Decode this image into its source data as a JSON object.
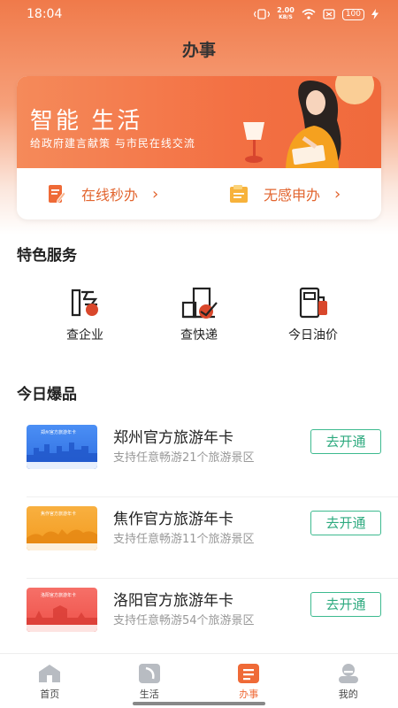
{
  "status_bar": {
    "time": "18:04",
    "net_speed_value": "2.00",
    "net_speed_unit": "KB/S",
    "battery": "100"
  },
  "header": {
    "title": "办事"
  },
  "banner": {
    "title": "智能 生活",
    "subtitle": "给政府建言献策 与市民在线交流",
    "actions": [
      {
        "label": "在线秒办",
        "icon": "edit-doc-icon"
      },
      {
        "label": "无感申办",
        "icon": "folder-doc-icon"
      }
    ],
    "arrow": "›"
  },
  "featured": {
    "title": "特色服务",
    "items": [
      {
        "label": "查企业",
        "icon": "enterprise-icon"
      },
      {
        "label": "查快递",
        "icon": "express-icon"
      },
      {
        "label": "今日油价",
        "icon": "fuel-icon"
      }
    ]
  },
  "hot": {
    "title": "今日爆品",
    "items": [
      {
        "title": "郑州官方旅游年卡",
        "subtitle": "支持任意畅游21个旅游景区",
        "button": "去开通",
        "card_text": "郑州官方旅游年卡",
        "color": "#3b7cf2"
      },
      {
        "title": "焦作官方旅游年卡",
        "subtitle": "支持任意畅游11个旅游景区",
        "button": "去开通",
        "card_text": "焦作官方旅游年卡",
        "color": "#f5a030"
      },
      {
        "title": "洛阳官方旅游年卡",
        "subtitle": "支持任意畅游54个旅游景区",
        "button": "去开通",
        "card_text": "洛阳官方旅游年卡",
        "color": "#f0605a"
      }
    ]
  },
  "tabs": [
    {
      "label": "首页",
      "icon": "home-icon",
      "active": false
    },
    {
      "label": "生活",
      "icon": "life-icon",
      "active": false
    },
    {
      "label": "办事",
      "icon": "service-icon",
      "active": true
    },
    {
      "label": "我的",
      "icon": "profile-icon",
      "active": false
    }
  ],
  "colors": {
    "accent": "#ef6a37",
    "green": "#2eaa7f"
  }
}
